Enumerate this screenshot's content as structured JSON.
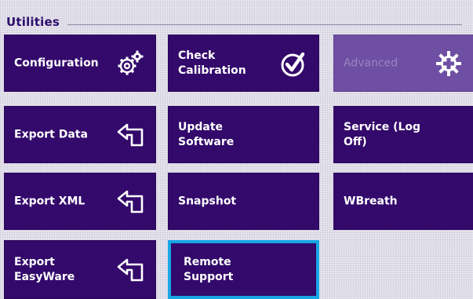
{
  "group": {
    "title": "Utilities"
  },
  "tiles": [
    {
      "label": "Configuration",
      "icon": "gears-icon",
      "state": "normal"
    },
    {
      "label": "Check\nCalibration",
      "icon": "check-circle-icon",
      "state": "normal"
    },
    {
      "label": "Advanced",
      "icon": "service-cross-icon",
      "state": "disabled"
    },
    {
      "label": "Export Data",
      "icon": "export-arrow-icon",
      "state": "normal"
    },
    {
      "label": "Update Software",
      "icon": "",
      "state": "normal"
    },
    {
      "label": "Service (Log Off)",
      "icon": "",
      "state": "normal"
    },
    {
      "label": "Export XML",
      "icon": "export-arrow-icon",
      "state": "normal"
    },
    {
      "label": "Snapshot",
      "icon": "",
      "state": "normal"
    },
    {
      "label": "WBreath",
      "icon": "",
      "state": "normal"
    },
    {
      "label": "Export\nEasyWare",
      "icon": "export-arrow-icon",
      "state": "normal"
    },
    {
      "label": "Remote Support",
      "icon": "",
      "state": "selected"
    }
  ],
  "colors": {
    "tile": "#33096b",
    "tile_disabled": "#6e4fa3",
    "selection_border": "#18a6e4",
    "header_text": "#2e0e6e"
  }
}
